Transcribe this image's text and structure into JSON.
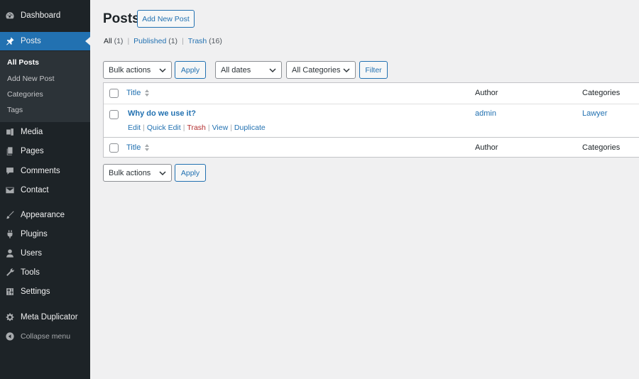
{
  "sidebar": {
    "dashboard": "Dashboard",
    "posts": "Posts",
    "posts_sub": [
      "All Posts",
      "Add New Post",
      "Categories",
      "Tags"
    ],
    "media": "Media",
    "pages": "Pages",
    "comments": "Comments",
    "contact": "Contact",
    "appearance": "Appearance",
    "plugins": "Plugins",
    "users": "Users",
    "tools": "Tools",
    "settings": "Settings",
    "meta_duplicator": "Meta Duplicator",
    "collapse": "Collapse menu"
  },
  "header": {
    "title": "Posts",
    "add_new": "Add New Post"
  },
  "filters_links": {
    "all": "All",
    "all_count": "(1)",
    "published": "Published",
    "published_count": "(1)",
    "trash": "Trash",
    "trash_count": "(16)",
    "separator": "|"
  },
  "toolbar": {
    "bulk_actions": "Bulk actions",
    "apply": "Apply",
    "dates": "All dates",
    "categories": "All Categories",
    "filter": "Filter"
  },
  "table": {
    "columns": {
      "title": "Title",
      "author": "Author",
      "categories": "Categories"
    },
    "rows": [
      {
        "title": "Why do we use it?",
        "author": "admin",
        "category": "Lawyer",
        "actions": [
          "Edit",
          "Quick Edit",
          "Trash",
          "View",
          "Duplicate"
        ]
      }
    ]
  },
  "colors": {
    "accent": "#2271b1",
    "sidebar_bg": "#1d2327",
    "trash": "#b32d2e"
  }
}
